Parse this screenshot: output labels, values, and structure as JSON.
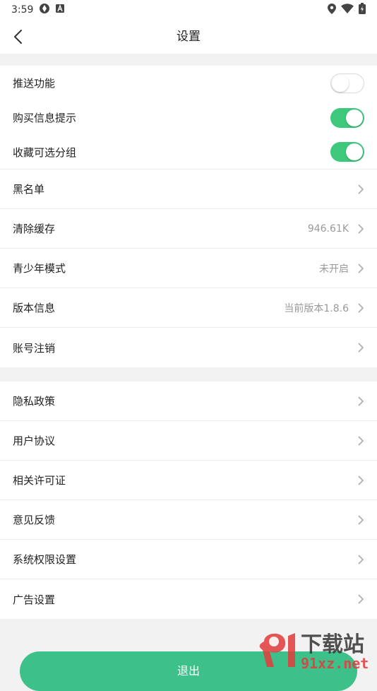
{
  "status_bar": {
    "time": "3:59"
  },
  "header": {
    "title": "设置"
  },
  "toggles": [
    {
      "label": "推送功能",
      "on": false
    },
    {
      "label": "购买信息提示",
      "on": true
    },
    {
      "label": "收藏可选分组",
      "on": true
    }
  ],
  "section1": [
    {
      "label": "黑名单",
      "value": ""
    },
    {
      "label": "清除缓存",
      "value": "946.61K"
    },
    {
      "label": "青少年模式",
      "value": "未开启"
    },
    {
      "label": "版本信息",
      "value": "当前版本1.8.6"
    },
    {
      "label": "账号注销",
      "value": ""
    }
  ],
  "section2": [
    {
      "label": "隐私政策"
    },
    {
      "label": "用户协议"
    },
    {
      "label": "相关许可证"
    },
    {
      "label": "意见反馈"
    },
    {
      "label": "系统权限设置"
    },
    {
      "label": "广告设置"
    }
  ],
  "logout_label": "退出",
  "watermark": {
    "brand": "下载站",
    "url": "91xz.net"
  },
  "colors": {
    "toggle_on": "#3dc87c",
    "logout_button": "#3ec08a"
  }
}
